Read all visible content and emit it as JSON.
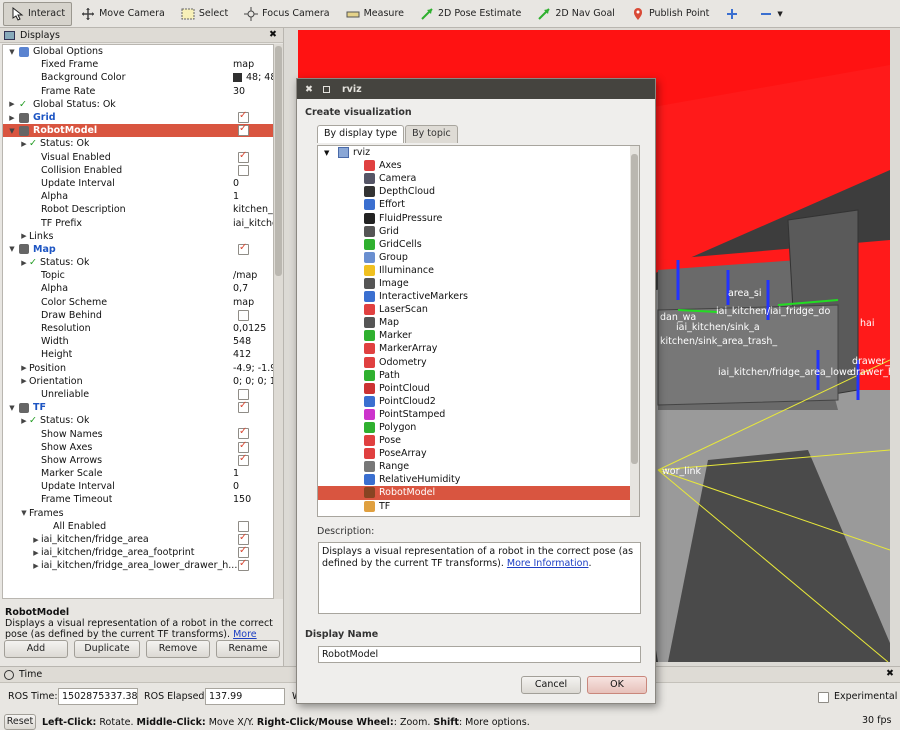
{
  "toolbar": {
    "items": [
      "Interact",
      "Move Camera",
      "Select",
      "Focus Camera",
      "Measure",
      "2D Pose Estimate",
      "2D Nav Goal",
      "Publish Point"
    ]
  },
  "displays_panel": {
    "title": "Displays",
    "rows": [
      {
        "name": "Global Options",
        "value": "",
        "indent": 0,
        "arrow": "down"
      },
      {
        "name": "Fixed Frame",
        "value": "map",
        "indent": 2
      },
      {
        "name": "Background Color",
        "value": "48; 48;",
        "indent": 2
      },
      {
        "name": "Frame Rate",
        "value": "30",
        "indent": 2
      },
      {
        "name": "Global Status: Ok",
        "value": "",
        "indent": 0,
        "arrow": "right"
      },
      {
        "name": "Grid",
        "value": "",
        "indent": 0,
        "arrow": "right"
      },
      {
        "name": "RobotModel",
        "value": "",
        "indent": 0,
        "arrow": "down"
      },
      {
        "name": "Status: Ok",
        "value": "",
        "indent": 1,
        "arrow": "right"
      },
      {
        "name": "Visual Enabled",
        "value": "",
        "indent": 2
      },
      {
        "name": "Collision Enabled",
        "value": "",
        "indent": 2
      },
      {
        "name": "Update Interval",
        "value": "0",
        "indent": 2
      },
      {
        "name": "Alpha",
        "value": "1",
        "indent": 2
      },
      {
        "name": "Robot Description",
        "value": "kitchen_...",
        "indent": 2
      },
      {
        "name": "TF Prefix",
        "value": "iai_kitche",
        "indent": 2
      },
      {
        "name": "Links",
        "value": "",
        "indent": 1,
        "arrow": "right"
      },
      {
        "name": "Map",
        "value": "",
        "indent": 0,
        "arrow": "down"
      },
      {
        "name": "Status: Ok",
        "value": "",
        "indent": 1,
        "arrow": "right"
      },
      {
        "name": "Topic",
        "value": "/map",
        "indent": 2
      },
      {
        "name": "Alpha",
        "value": "0,7",
        "indent": 2
      },
      {
        "name": "Color Scheme",
        "value": "map",
        "indent": 2
      },
      {
        "name": "Draw Behind",
        "value": "",
        "indent": 2
      },
      {
        "name": "Resolution",
        "value": "0,0125",
        "indent": 2
      },
      {
        "name": "Width",
        "value": "548",
        "indent": 2
      },
      {
        "name": "Height",
        "value": "412",
        "indent": 2
      },
      {
        "name": "Position",
        "value": "-4.9; -1.9;",
        "indent": 1,
        "arrow": "right"
      },
      {
        "name": "Orientation",
        "value": "0; 0; 0; 1",
        "indent": 1,
        "arrow": "right"
      },
      {
        "name": "Unreliable",
        "value": "",
        "indent": 2
      },
      {
        "name": "TF",
        "value": "",
        "indent": 0,
        "arrow": "down"
      },
      {
        "name": "Status: Ok",
        "value": "",
        "indent": 1,
        "arrow": "right"
      },
      {
        "name": "Show Names",
        "value": "",
        "indent": 2
      },
      {
        "name": "Show Axes",
        "value": "",
        "indent": 2
      },
      {
        "name": "Show Arrows",
        "value": "",
        "indent": 2
      },
      {
        "name": "Marker Scale",
        "value": "1",
        "indent": 2
      },
      {
        "name": "Update Interval",
        "value": "0",
        "indent": 2
      },
      {
        "name": "Frame Timeout",
        "value": "150",
        "indent": 2
      },
      {
        "name": "Frames",
        "value": "",
        "indent": 1,
        "arrow": "down"
      },
      {
        "name": "All Enabled",
        "value": "",
        "indent": 3
      },
      {
        "name": "iai_kitchen/fridge_area",
        "value": "",
        "indent": 2,
        "arrow": "right"
      },
      {
        "name": "iai_kitchen/fridge_area_footprint",
        "value": "",
        "indent": 2,
        "arrow": "right"
      },
      {
        "name": "iai_kitchen/fridge_area_lower_drawer_h...",
        "value": "",
        "indent": 2,
        "arrow": "right"
      }
    ],
    "description_title": "RobotModel",
    "description_text": "Displays a visual representation of a robot in the correct pose (as defined by the current TF transforms).",
    "more_info": "More Information",
    "buttons": [
      "Add",
      "Duplicate",
      "Remove",
      "Rename"
    ]
  },
  "time_panel": {
    "title": "Time",
    "ros_time_label": "ROS Time:",
    "ros_time_value": "1502875337.38",
    "ros_elapsed_label": "ROS Elapsed:",
    "ros_elapsed_value": "137.99",
    "wall_label": "W",
    "experimental_label": "Experimental",
    "reset_label": "Reset",
    "hint_left": "Left-Click:",
    "hint_left_t": " Rotate. ",
    "hint_mid": "Middle-Click:",
    "hint_mid_t": " Move X/Y. ",
    "hint_right": "Right-Click/Mouse Wheel:",
    "hint_right_t": ": Zoom. ",
    "hint_shift": "Shift",
    "hint_shift_t": ": More options.",
    "fps": "30 fps"
  },
  "viewport_labels": [
    "iai_kitchen/iai_fridge_do",
    "iai_kitchen/sink_a",
    "kitchen/sink_area_trash_",
    "iai_kitchen/fridge_area_lowe",
    "drawer_m",
    "drawer_ha",
    "hai",
    "dan_wa",
    "a_sin",
    "area_si",
    "wor_link"
  ],
  "dialog": {
    "window_title": "rviz",
    "heading": "Create visualization",
    "tabs": [
      "By display type",
      "By topic"
    ],
    "root": "rviz",
    "items": [
      "Axes",
      "Camera",
      "DepthCloud",
      "Effort",
      "FluidPressure",
      "Grid",
      "GridCells",
      "Group",
      "Illuminance",
      "Image",
      "InteractiveMarkers",
      "LaserScan",
      "Map",
      "Marker",
      "MarkerArray",
      "Odometry",
      "Path",
      "PointCloud",
      "PointCloud2",
      "PointStamped",
      "Polygon",
      "Pose",
      "PoseArray",
      "Range",
      "RelativeHumidity",
      "RobotModel",
      "TF"
    ],
    "selected": "RobotModel",
    "description_label": "Description:",
    "description_text": "Displays a visual representation of a robot in the correct pose (as defined by the current TF transforms).",
    "more_info": "More Information",
    "display_name_label": "Display Name",
    "display_name_value": "RobotModel",
    "cancel": "Cancel",
    "ok": "OK"
  },
  "colors": {
    "selection": "#d95540",
    "link": "#1d3fc3",
    "red_plane": "#ff1a1a"
  }
}
